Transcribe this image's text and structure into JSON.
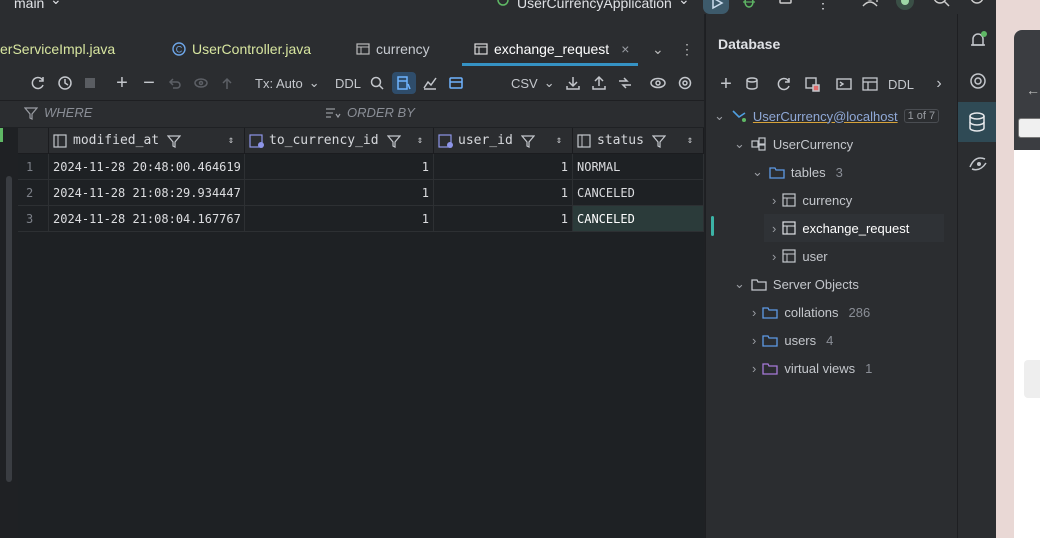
{
  "topbar": {
    "branch": "main",
    "run_config": "UserCurrencyApplication"
  },
  "tabs": [
    {
      "label": "erServiceImpl.java",
      "type": "java"
    },
    {
      "label": "UserController.java",
      "type": "class"
    },
    {
      "label": "currency",
      "type": "table"
    },
    {
      "label": "exchange_request",
      "type": "table",
      "active": true
    }
  ],
  "tool_window_title": "Database",
  "toolbar": {
    "tx_mode": "Tx: Auto",
    "ddl": "DDL",
    "export_format": "CSV"
  },
  "filters": {
    "where_label": "WHERE",
    "order_by_label": "ORDER BY"
  },
  "grid": {
    "columns": [
      {
        "name": "modified_at",
        "type": "column"
      },
      {
        "name": "to_currency_id",
        "type": "foreign-key"
      },
      {
        "name": "user_id",
        "type": "foreign-key"
      },
      {
        "name": "status",
        "type": "column"
      }
    ],
    "rows": [
      {
        "num": "1",
        "modified_at": "2024-11-28 20:48:00.464619",
        "to_currency_id": "1",
        "user_id": "1",
        "status": "NORMAL"
      },
      {
        "num": "2",
        "modified_at": "2024-11-28 21:08:29.934447",
        "to_currency_id": "1",
        "user_id": "1",
        "status": "CANCELED"
      },
      {
        "num": "3",
        "modified_at": "2024-11-28 21:08:04.167767",
        "to_currency_id": "1",
        "user_id": "1",
        "status": "CANCELED"
      }
    ]
  },
  "db_panel": {
    "ddl": "DDL",
    "datasource": "UserCurrency@localhost",
    "datasource_badge": "1 of 7",
    "schema": "UserCurrency",
    "tables_label": "tables",
    "tables_count": "3",
    "tables": [
      "currency",
      "exchange_request",
      "user"
    ],
    "server_objects": "Server Objects",
    "collations_label": "collations",
    "collations_count": "286",
    "users_label": "users",
    "users_count": "4",
    "virtual_views_label": "virtual views",
    "virtual_views_count": "1"
  },
  "colors": {
    "accent": "#3592c4",
    "selection": "#2e436e",
    "folder": "#5e9ae6",
    "ok": "#5fb865"
  }
}
